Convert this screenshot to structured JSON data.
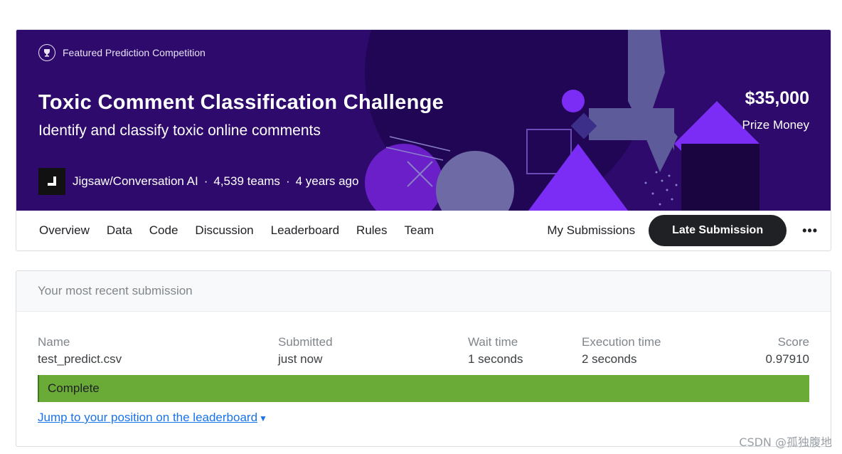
{
  "banner": {
    "featured_label": "Featured Prediction Competition",
    "title": "Toxic Comment Classification Challenge",
    "subtitle": "Identify and classify toxic online comments",
    "host": "Jigsaw/Conversation AI",
    "teams": "4,539 teams",
    "time_ago": "4 years ago",
    "separator": "·",
    "prize_amount": "$35,000",
    "prize_label": "Prize Money",
    "colors": {
      "background": "#2d0a6b",
      "accent": "#7b2cf5"
    }
  },
  "nav": {
    "tabs": [
      "Overview",
      "Data",
      "Code",
      "Discussion",
      "Leaderboard",
      "Rules",
      "Team"
    ],
    "my_submissions": "My Submissions",
    "late_submission": "Late Submission",
    "more": "•••"
  },
  "submission": {
    "header": "Your most recent submission",
    "columns": {
      "name": {
        "label": "Name",
        "value": "test_predict.csv"
      },
      "submitted": {
        "label": "Submitted",
        "value": "just now"
      },
      "wait": {
        "label": "Wait time",
        "value": "1 seconds"
      },
      "execution": {
        "label": "Execution time",
        "value": "2 seconds"
      },
      "score": {
        "label": "Score",
        "value": "0.97910"
      }
    },
    "status": "Complete",
    "status_color": "#6aab38",
    "jump_link": "Jump to your position on the leaderboard",
    "link_color": "#1a73e8"
  },
  "watermark": "CSDN @孤独腹地"
}
